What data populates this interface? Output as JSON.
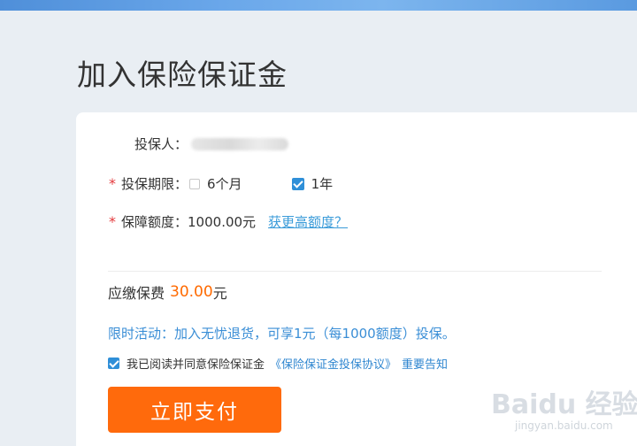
{
  "page": {
    "title": "加入保险保证金"
  },
  "form": {
    "insured_label": "投保人：",
    "required_mark": "*",
    "period_label": "投保期限：",
    "period_option_1": "6个月",
    "period_option_2": "1年",
    "period_option_2_checked": true,
    "amount_label": "保障额度：",
    "amount_value": "1000.00元",
    "amount_link": "获更高额度？"
  },
  "fee": {
    "label": "应缴保费",
    "amount": "30.00",
    "unit": "元"
  },
  "promo": {
    "text": "限时活动：加入无忧退货，可享1元（每1000额度）投保。"
  },
  "agreement": {
    "text": "我已阅读并同意保险保证金",
    "link1": "《保险保证金投保协议》",
    "link2": "重要告知"
  },
  "actions": {
    "pay_label": "立即支付"
  },
  "watermark": {
    "brand": "Baidu 经验",
    "url": "jingyan.baidu.com"
  },
  "colors": {
    "accent": "#ff6a0c",
    "link": "#3a9bd9",
    "checkbox": "#2f8fd8",
    "required": "#e4393c"
  }
}
